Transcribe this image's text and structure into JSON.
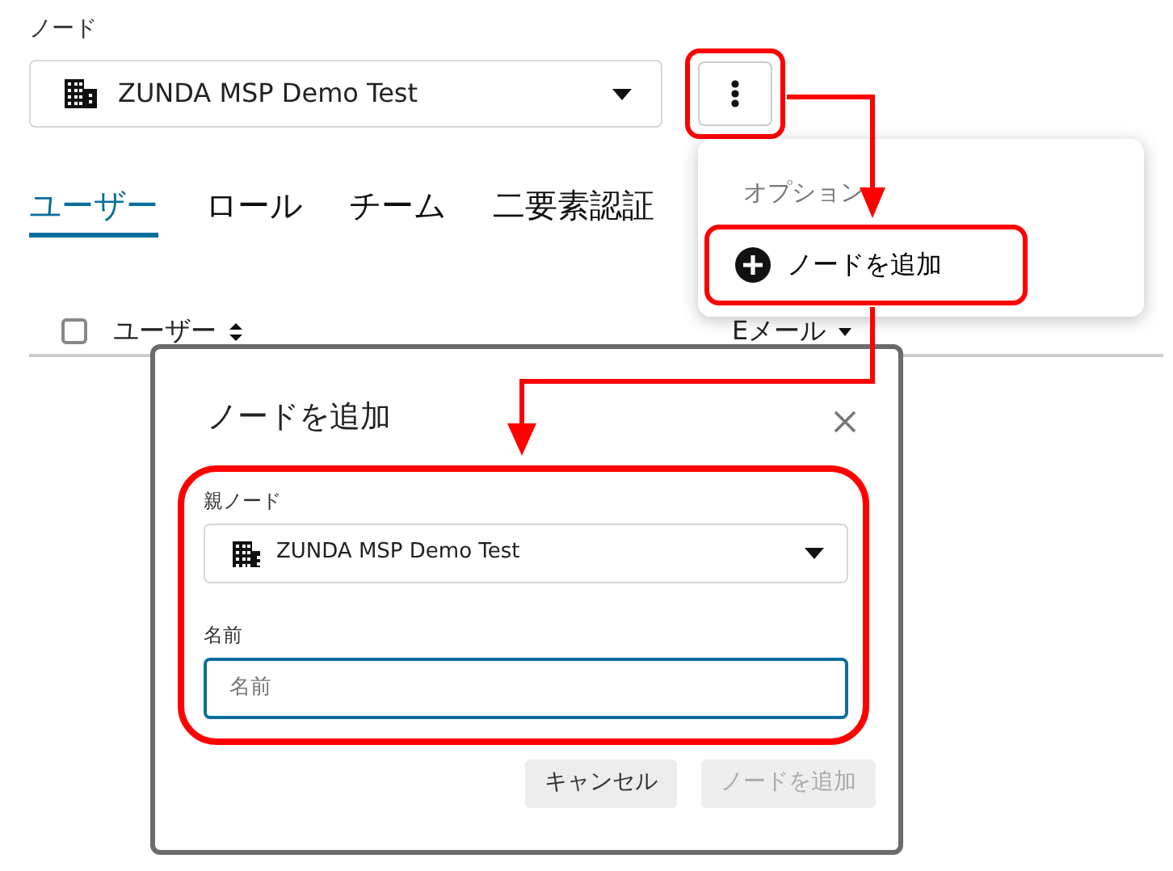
{
  "node_field": {
    "label": "ノード",
    "value": "ZUNDA MSP Demo Test"
  },
  "more_button": {
    "highlighted": true
  },
  "tabs": [
    {
      "label": "ユーザー",
      "selected": true
    },
    {
      "label": "ロール",
      "selected": false
    },
    {
      "label": "チーム",
      "selected": false
    },
    {
      "label": "二要素認証",
      "selected": false
    }
  ],
  "table": {
    "select_all_checked": false,
    "columns": [
      {
        "label": "ユーザー",
        "sorted": false
      },
      {
        "label": "Eメール",
        "sorted": true
      }
    ]
  },
  "options_menu": {
    "heading": "オプション",
    "items": [
      {
        "label": "ノードを追加",
        "highlighted": true
      }
    ]
  },
  "dialog": {
    "title": "ノードを追加",
    "fields_highlighted": true,
    "fields": [
      {
        "kind": "select",
        "label": "親ノード",
        "value": "ZUNDA MSP Demo Test"
      },
      {
        "kind": "text",
        "label": "名前",
        "placeholder": "名前",
        "focused": true
      }
    ],
    "buttons": [
      {
        "label": "キャンセル",
        "disabled": false
      },
      {
        "label": "ノードを追加",
        "disabled": true
      }
    ]
  }
}
